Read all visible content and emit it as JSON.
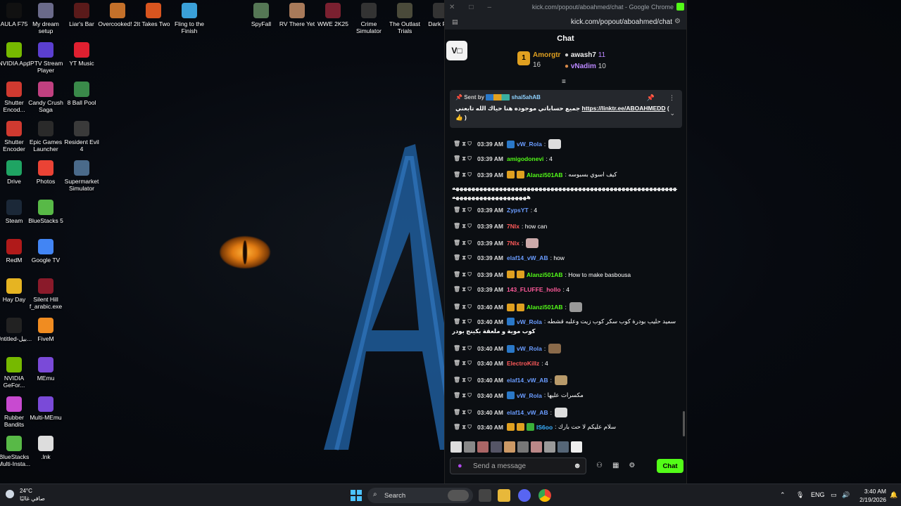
{
  "desktop": {
    "icons": [
      {
        "label": "AULA F75",
        "color": "#111"
      },
      {
        "label": "My dream setup",
        "color": "#6a6a8a"
      },
      {
        "label": "Liar's Bar",
        "color": "#5a1a1a"
      },
      {
        "label": "Overcooked! 2",
        "color": "#c4702a"
      },
      {
        "label": "It Takes Two",
        "color": "#d8551f"
      },
      {
        "label": "Fling to the Finish",
        "color": "#3aa0d8"
      },
      {
        "label": "SpyFall",
        "color": "#557755"
      },
      {
        "label": "RV There Yet",
        "color": "#a87a5a"
      },
      {
        "label": "WWE 2K25",
        "color": "#7a2030"
      },
      {
        "label": "Crime Simulator",
        "color": "#333"
      },
      {
        "label": "The Outlast Trials",
        "color": "#4a4a3a"
      },
      {
        "label": "Dark Prol",
        "color": "#333"
      },
      {
        "label": "NVIDIA App",
        "color": "#76b900"
      },
      {
        "label": "IPTV Stream Player",
        "color": "#5b3fd0"
      },
      {
        "label": "YT Music",
        "color": "#e02030"
      },
      {
        "label": "Shutter Encod...",
        "color": "#d03a30"
      },
      {
        "label": "Candy Crush Saga",
        "color": "#c04080"
      },
      {
        "label": "8 Ball Pool",
        "color": "#3a8a4a"
      },
      {
        "label": "Shutter Encoder",
        "color": "#d03a30"
      },
      {
        "label": "Epic Games Launcher",
        "color": "#2a2a2a"
      },
      {
        "label": "Resident Evil 4",
        "color": "#3a3a3a"
      },
      {
        "label": "Drive",
        "color": "#1fa463"
      },
      {
        "label": "Photos",
        "color": "#ea4335"
      },
      {
        "label": "Supermarket Simulator",
        "color": "#4a6a8a"
      },
      {
        "label": "Steam",
        "color": "#1b2838"
      },
      {
        "label": "BlueStacks 5",
        "color": "#58b947"
      },
      {
        "label": "RedM",
        "color": "#b01a1a"
      },
      {
        "label": "Google TV",
        "color": "#4285f4"
      },
      {
        "label": "Hay Day",
        "color": "#e6b422"
      },
      {
        "label": "Silent Hill f_arabic.exe",
        "color": "#8a1a2a"
      },
      {
        "label": "Untitled-بيل...",
        "color": "#222"
      },
      {
        "label": "FiveM",
        "color": "#f08c21"
      },
      {
        "label": "NVIDIA GeFor...",
        "color": "#76b900"
      },
      {
        "label": "MEmu",
        "color": "#7a4ad8"
      },
      {
        "label": "Rubber Bandits",
        "color": "#c84ad0"
      },
      {
        "label": "Multi-MEmu",
        "color": "#7a4ad8"
      },
      {
        "label": "BlueStacks Multi-Insta...",
        "color": "#58b947"
      },
      {
        "label": ".lnk",
        "color": "#ddd"
      }
    ]
  },
  "browser": {
    "window_title": "kick.com/popout/aboahmed/chat - Google Chrome",
    "url": "kick.com/popout/aboahmed/chat",
    "accent": "#53fc18"
  },
  "chat": {
    "header": "Chat",
    "gifters": {
      "first": {
        "rank": "1",
        "name": "Amorgtr",
        "count": "16"
      },
      "second": {
        "name": "awash7",
        "count": "11"
      },
      "third": {
        "name": "vNadim",
        "count": "10"
      }
    },
    "pinned": {
      "sent_by": "Sent by",
      "sender": "shai5ahAB",
      "message": "جميع حساباتي موجوده هنا حياك الله تابعني",
      "link": "https://linktr.ee/ABOAHMEDD",
      "suffix": "(",
      "tail": ")"
    },
    "messages": [
      {
        "time": "03:39 AM",
        "user": "vW_Rola",
        "color": "#6a9cff",
        "text": ":",
        "badges": [
          "#2a78c8"
        ],
        "emote": "#ddd"
      },
      {
        "time": "03:39 AM",
        "user": "amigodonevi",
        "color": "#53fc18",
        "text": ": 4",
        "badges": []
      },
      {
        "time": "03:39 AM",
        "user": "Alanzi501AB",
        "color": "#53fc18",
        "text": ": كيف اسوي بسبوسه",
        "badges": [
          "#e0a020",
          "#e0a020"
        ]
      },
      {
        "time": "03:39 AM",
        "user": "ZypsYT",
        "color": "#6a9cff",
        "text": ": 4",
        "badges": []
      },
      {
        "time": "03:39 AM",
        "user": "7Nlx",
        "color": "#ff5a5a",
        "text": ": how can",
        "badges": []
      },
      {
        "time": "03:39 AM",
        "user": "7Nlx",
        "color": "#ff5a5a",
        "text": ":",
        "badges": [],
        "emote": "#caa"
      },
      {
        "time": "03:39 AM",
        "user": "elaf14_vW_AB",
        "color": "#6a9cff",
        "text": ": how",
        "badges": []
      },
      {
        "time": "03:39 AM",
        "user": "Alanzi501AB",
        "color": "#53fc18",
        "text": ": How to make basbousa",
        "badges": [
          "#e0a020",
          "#e0a020"
        ]
      },
      {
        "time": "03:39 AM",
        "user": "143_FLUFFE_hollo",
        "color": "#ff5a9a",
        "text": ": 4",
        "badges": []
      },
      {
        "time": "03:40 AM",
        "user": "Alanzi501AB",
        "color": "#53fc18",
        "text": ":",
        "badges": [
          "#e0a020",
          "#e0a020"
        ],
        "emote": "#999"
      },
      {
        "time": "03:40 AM",
        "user": "vW_Rola",
        "color": "#6a9cff",
        "text": ": سميد حليب بودرة كوب سكر كوب زيت وعلبه قشطه",
        "badges": [
          "#2a78c8"
        ]
      },
      {
        "time": "03:40 AM",
        "user": "vW_Rola",
        "color": "#6a9cff",
        "text": ":",
        "badges": [
          "#2a78c8"
        ],
        "emote": "#8a6a4a"
      },
      {
        "time": "03:40 AM",
        "user": "ElectroKillz",
        "color": "#ff5a5a",
        "text": ": 4",
        "badges": []
      },
      {
        "time": "03:40 AM",
        "user": "elaf14_vW_AB",
        "color": "#6a9cff",
        "text": ":",
        "badges": [],
        "emote": "#b89a6a"
      },
      {
        "time": "03:40 AM",
        "user": "vW_Rola",
        "color": "#6a9cff",
        "text": ": مكسرات عليها",
        "badges": [
          "#2a78c8"
        ]
      },
      {
        "time": "03:40 AM",
        "user": "elaf14_vW_AB",
        "color": "#6a9cff",
        "text": ":",
        "badges": [],
        "emote": "#ddd"
      },
      {
        "time": "03:40 AM",
        "user": "IS6oo",
        "color": "#3ab0ff",
        "text": ": سلام عليكم لا حت بارك",
        "badges": [
          "#e0a020",
          "#e0a020",
          "#3ab03a"
        ]
      }
    ],
    "wrap_lines": [
      "ههههههههههههههههههههههههههههههههههههههههههههههههههههههههههههههههههههههههههههههه",
      "هههههههههههههههههههه",
      "كوب موية و ملعقة بكينج بودر"
    ],
    "input_placeholder": "Send a message",
    "send_label": "Chat"
  },
  "taskbar": {
    "temperature": "24°C",
    "condition": "صافي غالبًا",
    "search_label": "Search",
    "lang": "ENG",
    "time": "3:40 AM",
    "date": "2/19/2026"
  }
}
